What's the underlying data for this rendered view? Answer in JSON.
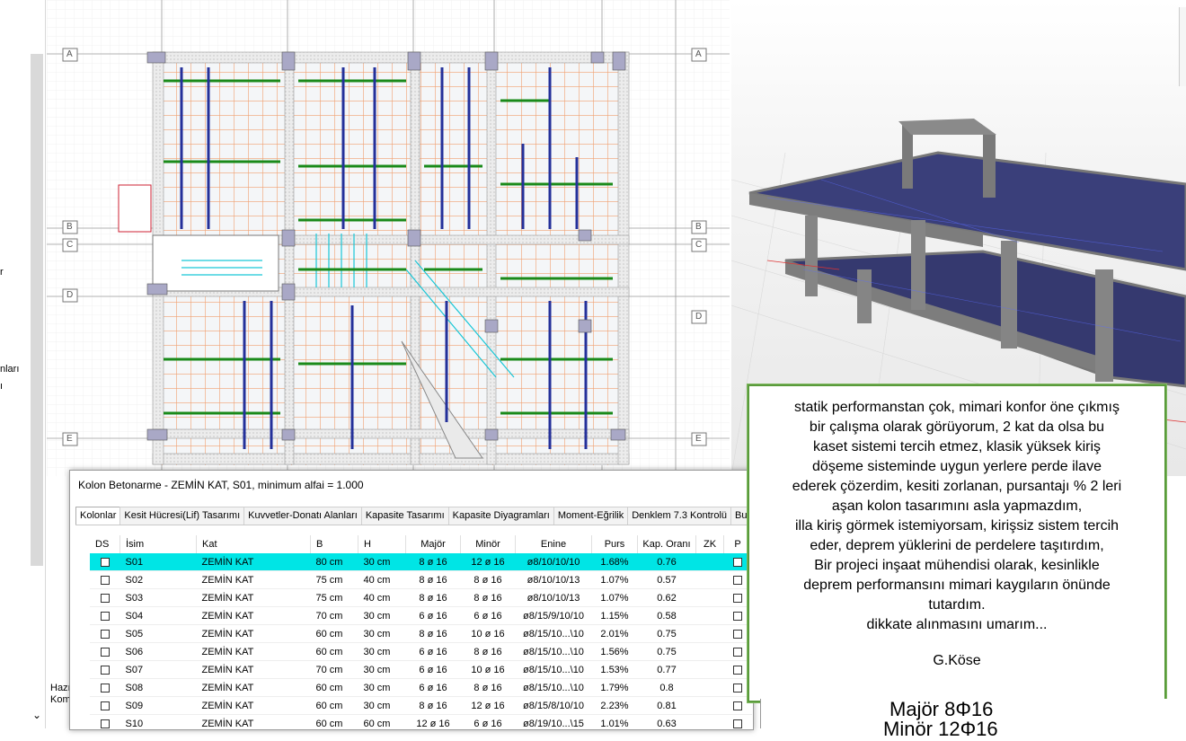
{
  "left_panel": {
    "texts": [
      "r",
      "nları",
      "ı"
    ]
  },
  "plan": {
    "axis_labels_left": [
      "A",
      "B",
      "C",
      "D",
      "E"
    ],
    "axis_labels_right": [
      "A",
      "B",
      "C",
      "D",
      "E"
    ]
  },
  "dialog": {
    "title": "Kolon Betonarme - ZEMİN KAT, S01, minimum alfai = 1.000",
    "tabs": [
      "Kolonlar",
      "Kesit Hücresi(Lif) Tasarımı",
      "Kuvvetler-Donatı Alanları",
      "Kapasite Tasarımı",
      "Kapasite Diyagramları",
      "Moment-Eğrilik",
      "Denklem 7.3 Kontrolü",
      "Burk"
    ],
    "columns": [
      "DS",
      "İsim",
      "Kat",
      "B",
      "H",
      "Majör",
      "Minör",
      "Enine",
      "Purs",
      "Kap. Oranı",
      "ZK",
      "P"
    ],
    "rows": [
      {
        "isim": "S01",
        "kat": "ZEMİN KAT",
        "b": "80 cm",
        "h": "30 cm",
        "major": "8 ø 16",
        "minor": "12 ø 16",
        "enine": "ø8/10/10/10",
        "purs": "1.68%",
        "kap": "0.76"
      },
      {
        "isim": "S02",
        "kat": "ZEMİN KAT",
        "b": "75 cm",
        "h": "40 cm",
        "major": "8 ø 16",
        "minor": "8 ø 16",
        "enine": "ø8/10/10/13",
        "purs": "1.07%",
        "kap": "0.57"
      },
      {
        "isim": "S03",
        "kat": "ZEMİN KAT",
        "b": "75 cm",
        "h": "40 cm",
        "major": "8 ø 16",
        "minor": "8 ø 16",
        "enine": "ø8/10/10/13",
        "purs": "1.07%",
        "kap": "0.62"
      },
      {
        "isim": "S04",
        "kat": "ZEMİN KAT",
        "b": "70 cm",
        "h": "30 cm",
        "major": "6 ø 16",
        "minor": "6 ø 16",
        "enine": "ø8/15/9/10/10",
        "purs": "1.15%",
        "kap": "0.58"
      },
      {
        "isim": "S05",
        "kat": "ZEMİN KAT",
        "b": "60 cm",
        "h": "30 cm",
        "major": "8 ø 16",
        "minor": "10 ø 16",
        "enine": "ø8/15/10...\\10",
        "purs": "2.01%",
        "kap": "0.75"
      },
      {
        "isim": "S06",
        "kat": "ZEMİN KAT",
        "b": "60 cm",
        "h": "30 cm",
        "major": "6 ø 16",
        "minor": "8 ø 16",
        "enine": "ø8/15/10...\\10",
        "purs": "1.56%",
        "kap": "0.75"
      },
      {
        "isim": "S07",
        "kat": "ZEMİN KAT",
        "b": "70 cm",
        "h": "30 cm",
        "major": "6 ø 16",
        "minor": "10 ø 16",
        "enine": "ø8/15/10...\\10",
        "purs": "1.53%",
        "kap": "0.77"
      },
      {
        "isim": "S08",
        "kat": "ZEMİN KAT",
        "b": "60 cm",
        "h": "30 cm",
        "major": "6 ø 16",
        "minor": "8 ø 16",
        "enine": "ø8/15/10...\\10",
        "purs": "1.79%",
        "kap": "0.8"
      },
      {
        "isim": "S09",
        "kat": "ZEMİN KAT",
        "b": "60 cm",
        "h": "30 cm",
        "major": "8 ø 16",
        "minor": "12 ø 16",
        "enine": "ø8/15/8/10/10",
        "purs": "2.23%",
        "kap": "0.81"
      },
      {
        "isim": "S10",
        "kat": "ZEMİN KAT",
        "b": "60 cm",
        "h": "60 cm",
        "major": "12 ø 16",
        "minor": "6 ø 16",
        "enine": "ø8/19/10...\\15",
        "purs": "1.01%",
        "kap": "0.63"
      }
    ]
  },
  "note": {
    "text": "statik performanstan çok, mimari konfor öne çıkmış\nbir çalışma olarak görüyorum, 2 kat da olsa bu\nkaset sistemi tercih etmez, klasik yüksek kiriş\ndöşeme sisteminde uygun yerlere perde ilave\nederek çözerdim, kesiti zorlanan, pursantajı % 2 leri\naşan kolon tasarımını asla yapmazdım,\nilla kiriş görmek istemiyorsam, kirişsiz sistem tercih\neder, deprem yüklerini de perdelere taşıtırdım,\nBir  projeci inşaat mühendisi olarak, kesinlikle\ndeprem performansını mimari   kaygıların önünde\ntutardım.\ndikkate alınmasını umarım...",
    "signature": "G.Köse"
  },
  "bottom_right": {
    "major": "Majör 8Φ16",
    "minor": "Minör 12Φ16"
  },
  "status": {
    "line1": "Hazı",
    "line2": "Kom"
  }
}
